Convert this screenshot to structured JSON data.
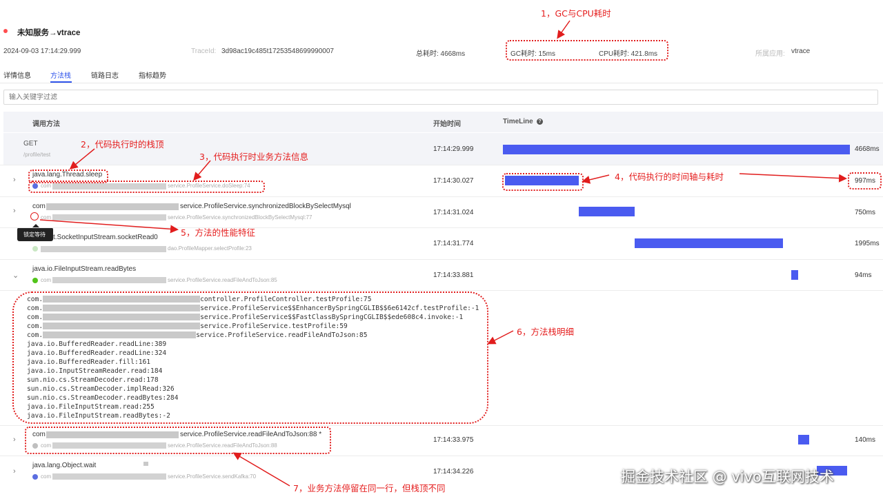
{
  "header": {
    "title": "未知服务→vtrace",
    "time": "2024-09-03 17:14:29.999",
    "traceid_label": "TraceId:",
    "traceid": "3d98ac19c485t17253548699990007",
    "total_label": "总耗时: 4668ms",
    "gc_label": "GC耗时: 15ms",
    "cpu_label": "CPU耗时: 421.8ms",
    "app_label": "所属应用:",
    "app": "vtrace"
  },
  "tabs": [
    "详情信息",
    "方法栈",
    "链路日志",
    "指标趋势"
  ],
  "filter": {
    "placeholder": "输入关键字过滤"
  },
  "columns": {
    "method": "调用方法",
    "start": "开始时间",
    "timeline": "TimeLine"
  },
  "rows": [
    {
      "name": "GET",
      "sub": "/profile/test",
      "start": "17:14:29.999",
      "duration": "4668ms"
    },
    {
      "name": "java.lang.Thread.sleep",
      "sub_prefix": "com",
      "sub": "service.ProfileService.doSleep:74",
      "start": "17:14:30.027",
      "duration": "997ms",
      "dot": "#5b6ee1"
    },
    {
      "name_prefix": "com",
      "name": "service.ProfileService.synchronizedBlockBySelectMysql",
      "sub_prefix": "com",
      "sub": "service.ProfileService.synchronizedBlockBySelectMysql:77",
      "start": "17:14:31.024",
      "duration": "750ms",
      "tooltip": "锁定等待"
    },
    {
      "name": "t.SocketInputStream.socketRead0",
      "sub": "dao.ProfileMapper.selectProfile:23",
      "start": "17:14:31.774",
      "duration": "1995ms",
      "dot": "#c9e7c3"
    },
    {
      "name": "java.io.FileInputStream.readBytes",
      "sub_prefix": "com",
      "sub": "service.ProfileService.readFileAndToJson:85",
      "start": "17:14:33.881",
      "duration": "94ms",
      "dot": "#52c41a"
    },
    {
      "name_prefix": "com",
      "name": "service.ProfileService.readFileAndToJson:88 *",
      "sub_prefix": "com",
      "sub": "service.ProfileService.readFileAndToJson:88",
      "start": "17:14:33.975",
      "duration": "140ms",
      "dot": "#bfbfbf"
    },
    {
      "name": "java.lang.Object.wait",
      "sub_prefix": "com",
      "sub": "service.ProfileService.sendKafka:70",
      "start": "17:14:34.226",
      "dot": "#5b6ee1"
    }
  ],
  "stack": [
    {
      "prefix": "com.",
      "text": "controller.ProfileController.testProfile:75"
    },
    {
      "prefix": "com.",
      "text": "service.ProfileService$$EnhancerBySpringCGLIB$$6e6142cf.testProfile:-1"
    },
    {
      "prefix": "com.",
      "text": "service.ProfileService$$FastClassBySpringCGLIB$$ede608c4.invoke:-1"
    },
    {
      "prefix": "com.",
      "text": "service.ProfileService.testProfile:59"
    },
    {
      "prefix": "com.",
      "text": "service.ProfileService.readFileAndToJson:85"
    },
    {
      "prefix": "",
      "text": "java.io.BufferedReader.readLine:389"
    },
    {
      "prefix": "",
      "text": "java.io.BufferedReader.readLine:324"
    },
    {
      "prefix": "",
      "text": "java.io.BufferedReader.fill:161"
    },
    {
      "prefix": "",
      "text": "java.io.InputStreamReader.read:184"
    },
    {
      "prefix": "",
      "text": "sun.nio.cs.StreamDecoder.read:178"
    },
    {
      "prefix": "",
      "text": "sun.nio.cs.StreamDecoder.implRead:326"
    },
    {
      "prefix": "",
      "text": "sun.nio.cs.StreamDecoder.readBytes:284"
    },
    {
      "prefix": "",
      "text": "java.io.FileInputStream.read:255"
    },
    {
      "prefix": "",
      "text": "java.io.FileInputStream.readBytes:-2"
    }
  ],
  "annotations": {
    "a1": "1，GC与CPU耗时",
    "a2": "2，代码执行时的栈顶",
    "a3": "3，代码执行时业务方法信息",
    "a4": "4，代码执行的时间轴与耗时",
    "a5": "5，方法的性能特征",
    "a6": "6，方法栈明细",
    "a7": "7，业务方法停留在同一行，但栈顶不同"
  },
  "watermark": "掘金技术社区 @ vivo互联网技术",
  "timeline": {
    "color": "#4a5bf0",
    "bars": [
      {
        "start": 0,
        "duration": 4668
      },
      {
        "start": 28,
        "duration": 997
      },
      {
        "start": 1025,
        "duration": 750
      },
      {
        "start": 1775,
        "duration": 1995
      },
      {
        "start": 3882,
        "duration": 94
      },
      {
        "start": 3976,
        "duration": 140
      },
      {
        "start": 4227,
        "duration": 400
      }
    ]
  }
}
